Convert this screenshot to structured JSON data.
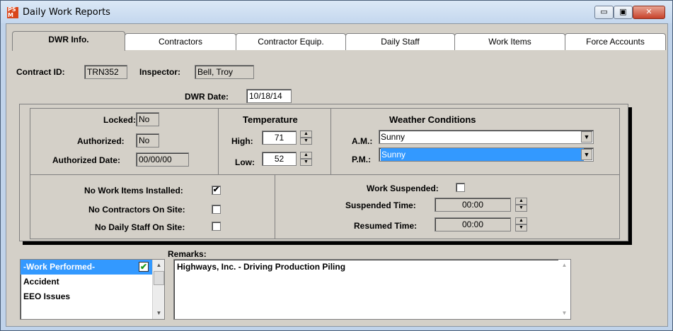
{
  "window": {
    "title": "Daily Work Reports",
    "controls": {
      "minimize": "▭",
      "maximize": "▣",
      "close": "✕"
    }
  },
  "tabs": [
    {
      "label": "DWR Info.",
      "active": true
    },
    {
      "label": "Contractors",
      "active": false
    },
    {
      "label": "Contractor Equip.",
      "active": false
    },
    {
      "label": "Daily Staff",
      "active": false
    },
    {
      "label": "Work Items",
      "active": false
    },
    {
      "label": "Force Accounts",
      "active": false
    }
  ],
  "header": {
    "contract_id_label": "Contract ID:",
    "contract_id": "TRN352",
    "inspector_label": "Inspector:",
    "inspector": "Bell, Troy",
    "dwr_date_label": "DWR Date:",
    "dwr_date": "10/18/14"
  },
  "status": {
    "locked_label": "Locked:",
    "locked": "No",
    "authorized_label": "Authorized:",
    "authorized": "No",
    "authorized_date_label": "Authorized Date:",
    "authorized_date": "00/00/00"
  },
  "temperature": {
    "title": "Temperature",
    "high_label": "High:",
    "high": "71",
    "low_label": "Low:",
    "low": "52"
  },
  "weather": {
    "title": "Weather Conditions",
    "am_label": "A.M.:",
    "am": "Sunny",
    "pm_label": "P.M.:",
    "pm": "Sunny"
  },
  "flags": {
    "no_work_items_label": "No Work Items Installed:",
    "no_work_items": true,
    "no_contractors_label": "No Contractors On Site:",
    "no_contractors": false,
    "no_daily_staff_label": "No Daily Staff On Site:",
    "no_daily_staff": false
  },
  "suspension": {
    "suspended_label": "Work Suspended:",
    "suspended": false,
    "suspended_time_label": "Suspended Time:",
    "suspended_time": "00:00",
    "resumed_time_label": "Resumed Time:",
    "resumed_time": "00:00"
  },
  "remarks": {
    "label": "Remarks:",
    "categories": [
      "-Work Performed-",
      "Accident",
      "EEO Issues"
    ],
    "selected_category": "-Work Performed-",
    "text": "Highways, Inc. - Driving Production Piling"
  },
  "colors": {
    "selection": "#3399ff",
    "face": "#d4d0c8",
    "titlebar": "#c4d7ee"
  }
}
